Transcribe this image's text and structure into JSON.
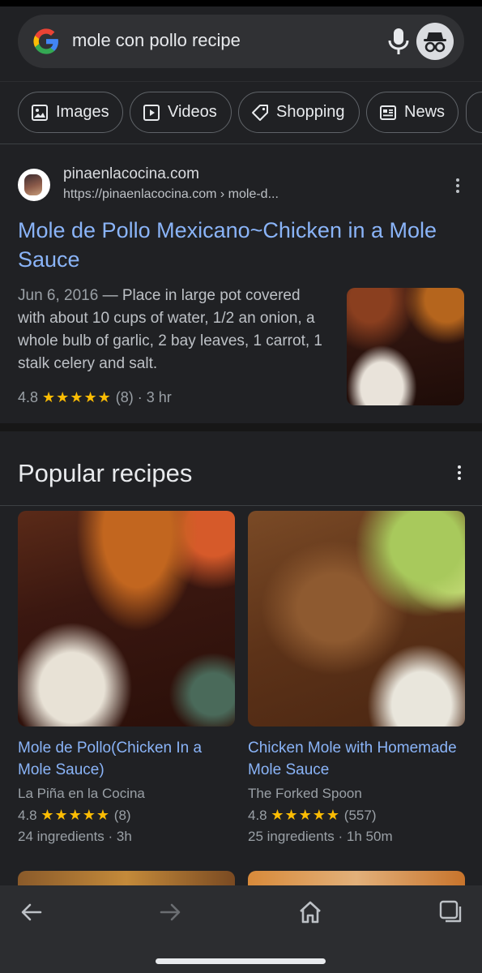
{
  "search": {
    "query": "mole con pollo recipe"
  },
  "chips": [
    {
      "label": "Images",
      "icon": "image-icon"
    },
    {
      "label": "Videos",
      "icon": "video-icon"
    },
    {
      "label": "Shopping",
      "icon": "tag-icon"
    },
    {
      "label": "News",
      "icon": "newspaper-icon"
    }
  ],
  "result": {
    "site_name": "pinaenlacocina.com",
    "url": "https://pinaenlacocina.com › mole-d...",
    "title": "Mole de Pollo Mexicano~Chicken in a Mole Sauce",
    "date": "Jun 6, 2016",
    "snippet": " — Place in large pot covered with about 10 cups of water, 1/2 an onion, a whole bulb of garlic, 2 bay leaves, 1 carrot, 1 stalk celery and salt.",
    "rating": "4.8",
    "stars": "★★★★★",
    "reviews": "(8)",
    "time": "· 3 hr"
  },
  "popular": {
    "title": "Popular recipes",
    "cards": [
      {
        "title": "Mole de Pollo(Chicken In a Mole Sauce)",
        "source": "La Piña en la Cocina",
        "rating": "4.8",
        "stars": "★★★★★",
        "reviews": "(8)",
        "meta": "24 ingredients · 3h"
      },
      {
        "title": "Chicken Mole with Homemade Mole Sauce",
        "source": "The Forked Spoon",
        "rating": "4.8",
        "stars": "★★★★★",
        "reviews": "(557)",
        "meta": "25 ingredients · 1h 50m"
      }
    ]
  },
  "colors": {
    "background": "#202124",
    "link": "#8ab4f8",
    "star": "#fbbc04",
    "muted": "#9aa0a6"
  }
}
